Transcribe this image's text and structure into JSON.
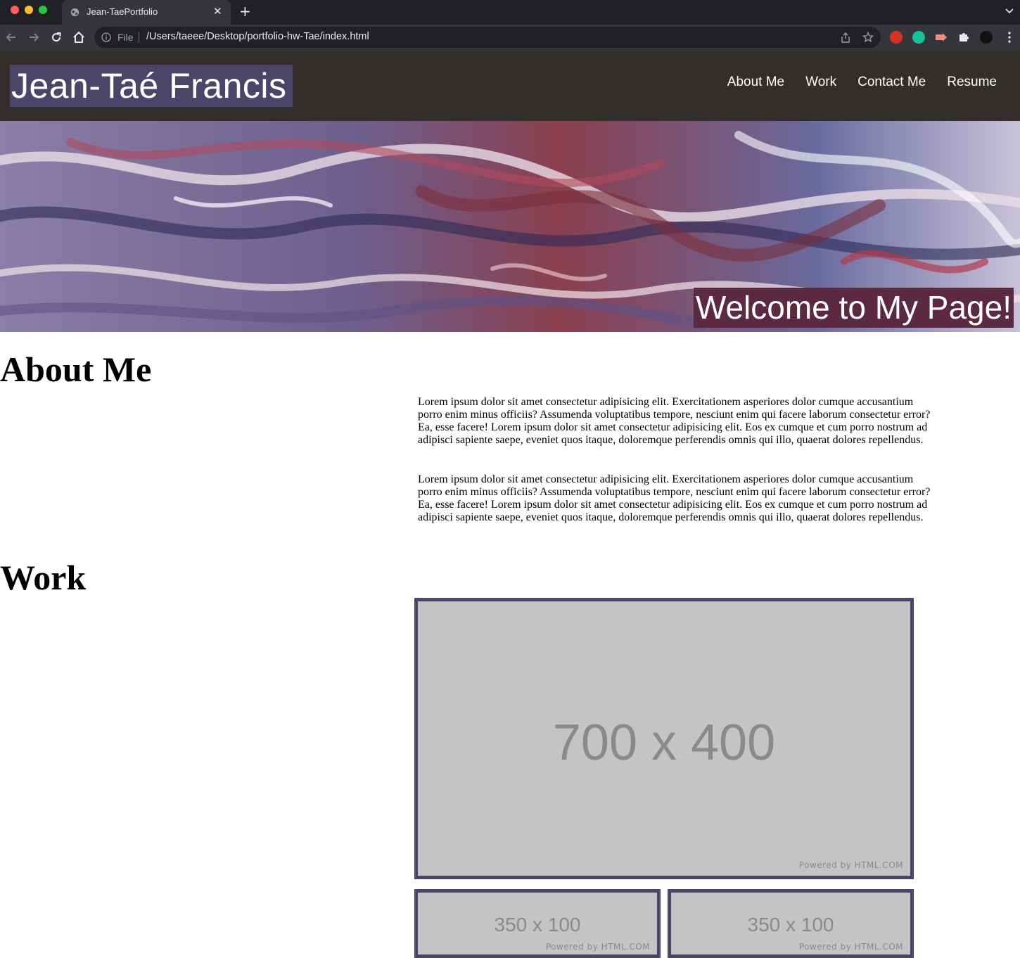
{
  "browser": {
    "tab_title": "Jean-TaePortfolio",
    "tab_close": "✕",
    "new_tab": "+",
    "address_prefix": "File",
    "url": "/Users/taeee/Desktop/portfolio-hw-Tae/index.html"
  },
  "site": {
    "brand": "Jean-Taé Francis",
    "nav": [
      "About Me",
      "Work",
      "Contact Me",
      "Resume"
    ],
    "hero_banner": "Welcome to My Page!"
  },
  "about": {
    "title": "About Me",
    "paragraphs": [
      "Lorem ipsum dolor sit amet consectetur adipisicing elit. Exercitationem asperiores dolor cumque accusantium porro enim minus officiis? Assumenda voluptatibus tempore, nesciunt enim qui facere laborum consectetur error? Ea, esse facere! Lorem ipsum dolor sit amet consectetur adipisicing elit. Eos ex cumque et cum porro nostrum ad adipisci sapiente saepe, eveniet quos itaque, doloremque perferendis omnis qui illo, quaerat dolores repellendus.",
      "Lorem ipsum dolor sit amet consectetur adipisicing elit. Exercitationem asperiores dolor cumque accusantium porro enim minus officiis? Assumenda voluptatibus tempore, nesciunt enim qui facere laborum consectetur error? Ea, esse facere! Lorem ipsum dolor sit amet consectetur adipisicing elit. Eos ex cumque et cum porro nostrum ad adipisci sapiente saepe, eveniet quos itaque, doloremque perferendis omnis qui illo, quaerat dolores repellendus."
    ]
  },
  "work": {
    "title": "Work",
    "placeholders": [
      {
        "label": "700 x 400",
        "powered": "Powered by HTML.COM"
      },
      {
        "label": "350 x 100",
        "powered": "Powered by HTML.COM"
      },
      {
        "label": "350 x 100",
        "powered": "Powered by HTML.COM"
      }
    ]
  },
  "colors": {
    "header_bg": "#312e2b",
    "brand_bg": "#4b4669",
    "banner_bg": "#5c2a3e",
    "placeholder_border": "#4b4669",
    "placeholder_fill": "#c4c4c4"
  },
  "icons": [
    "globe-icon",
    "back-icon",
    "forward-icon",
    "reload-icon",
    "home-icon",
    "info-icon",
    "share-icon",
    "star-icon",
    "extension-icon",
    "puzzle-icon",
    "profile-avatar",
    "menu-icon"
  ]
}
